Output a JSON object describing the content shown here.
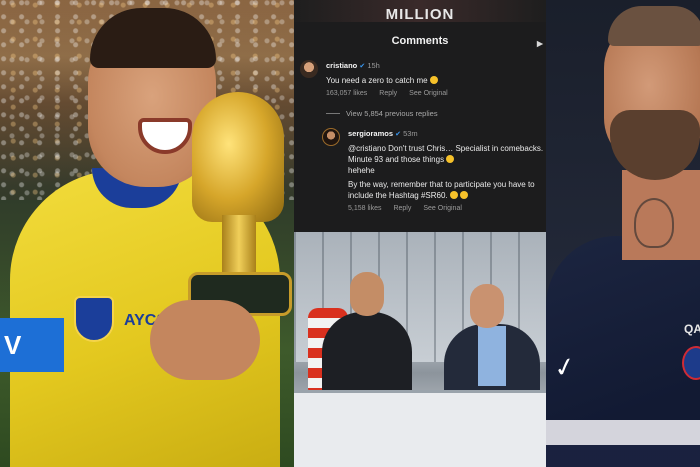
{
  "top_strip_text": "MILLION",
  "left_photo": {
    "armband_text": "V",
    "sponsor_text": "AYCS"
  },
  "comments": {
    "title": "Comments",
    "colors": {
      "sheet_bg": "#1c1c1d",
      "verified": "#3897f0",
      "meta": "#9a9a9a"
    },
    "items": [
      {
        "username": "cristiano",
        "verified_icon": "verified-badge-icon",
        "time": "15h",
        "text": "You need a zero to catch me",
        "likes": "163,057 likes",
        "reply": "Reply",
        "see_original": "See Original"
      }
    ],
    "view_previous": "View 5,854 previous replies",
    "reply": {
      "username": "sergioramos",
      "verified_icon": "verified-badge-icon",
      "time": "53m",
      "text_1": "@cristiano Don't trust Chris… Specialist in comebacks. Minute 93 and those things",
      "text_2": "hehehe",
      "text_3": "By the way, remember that to participate you have to include the Hashtag #SR60.",
      "likes": "5,158 likes",
      "reply": "Reply",
      "see_original": "See Original"
    }
  },
  "right_photo": {
    "jersey_text": "QA"
  }
}
